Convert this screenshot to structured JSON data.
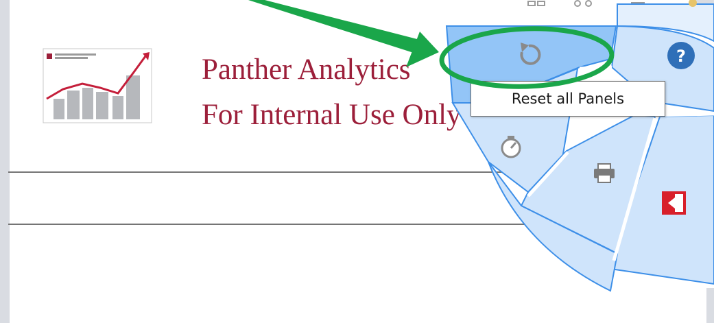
{
  "header": {
    "title_line1": "Panther Analytics",
    "title_line2": "For Internal Use Only"
  },
  "radial_menu": {
    "items": [
      {
        "id": "reset",
        "icon": "reset-icon",
        "tooltip": "Reset all Panels"
      },
      {
        "id": "help",
        "icon": "question-icon"
      },
      {
        "id": "speed",
        "icon": "stopwatch-icon"
      },
      {
        "id": "print",
        "icon": "printer-icon"
      },
      {
        "id": "export",
        "icon": "export-icon"
      }
    ],
    "tooltip_text": "Reset all Panels"
  },
  "annotation": {
    "arrow_color": "#1aa64a",
    "highlight_color": "#1aa64a"
  },
  "colors": {
    "title": "#9c1f3a",
    "menu_fill": "#cfe4fb",
    "menu_stroke": "#3d8fe8",
    "menu_active": "#93c5f7",
    "help_icon": "#2f6fb8",
    "export_icon": "#d81f2a"
  }
}
